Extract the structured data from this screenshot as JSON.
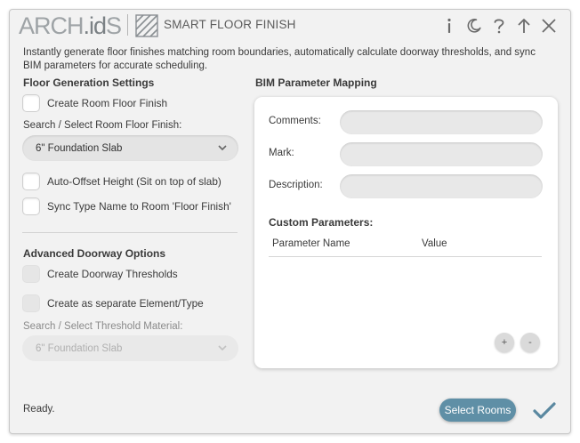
{
  "header": {
    "logo_left": "ARCH",
    "logo_dot": ".",
    "logo_mid": "id",
    "logo_right": "S",
    "app_title": "SMART FLOOR FINISH",
    "icons": [
      "info-icon",
      "moon-icon",
      "help-icon",
      "arrow-up-icon",
      "close-icon"
    ]
  },
  "description": "Instantly generate floor finishes matching room boundaries, automatically calculate doorway thresholds, and sync BIM parameters for accurate scheduling.",
  "floor_generation": {
    "title": "Floor Generation Settings",
    "create_room_floor_finish": "Create Room Floor Finish",
    "search_label": "Search / Select Room Floor Finish:",
    "selected_finish": "6\" Foundation Slab",
    "auto_offset": "Auto-Offset Height (Sit on top of slab)",
    "sync_type_name": "Sync Type Name to Room 'Floor Finish'"
  },
  "doorway": {
    "title": "Advanced Doorway Options",
    "create_thresholds": "Create Doorway Thresholds",
    "separate_element": "Create as separate Element/Type",
    "material_label": "Search / Select Threshold Material:",
    "selected_material": "6\" Foundation Slab"
  },
  "bim": {
    "title": "BIM Parameter Mapping",
    "comments_label": "Comments:",
    "comments_value": "",
    "mark_label": "Mark:",
    "mark_value": "",
    "description_label": "Description:",
    "description_value": "",
    "custom_title": "Custom Parameters:",
    "col_name": "Parameter Name",
    "col_value": "Value",
    "add_label": "+",
    "remove_label": "-"
  },
  "footer": {
    "status": "Ready.",
    "select_rooms": "Select Rooms"
  },
  "colors": {
    "accent": "#5f8fa6",
    "check": "#5a88a0",
    "background": "#f2f2f2"
  }
}
